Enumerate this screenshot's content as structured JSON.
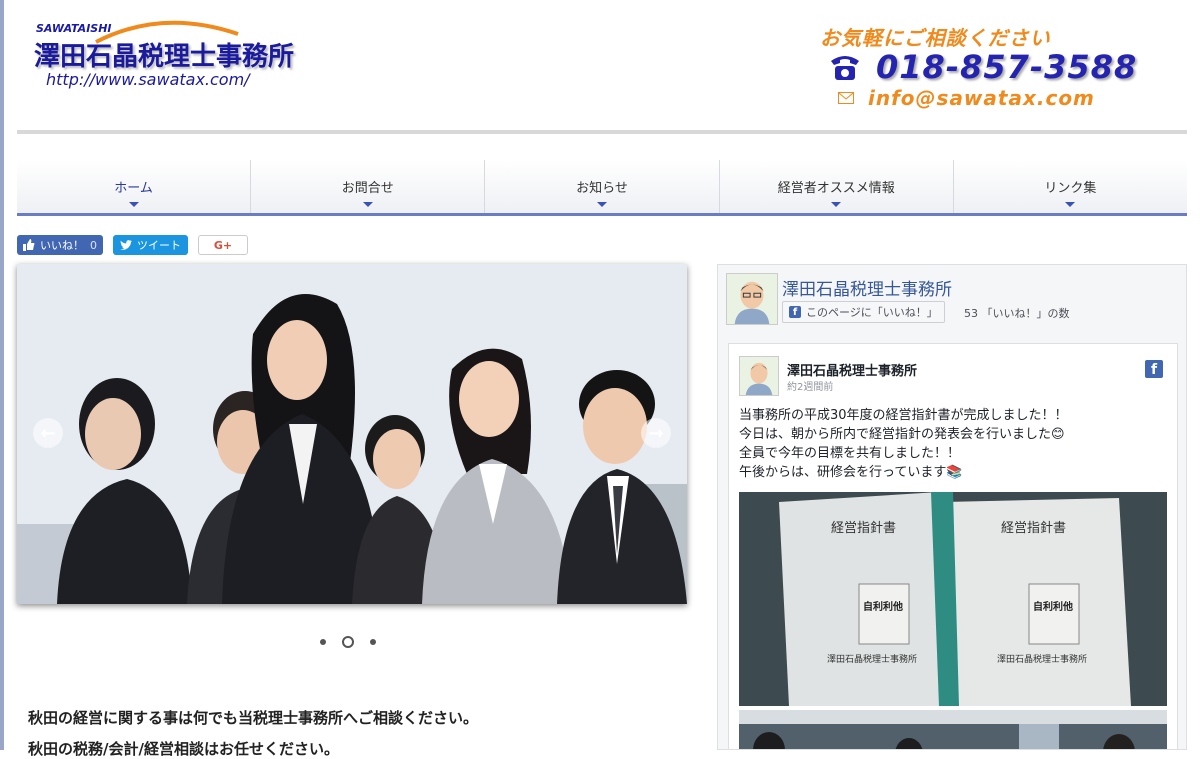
{
  "header": {
    "logo_small": "SAWATAISHI",
    "logo_name": "澤田石晶税理士事務所",
    "logo_url": "http://www.sawatax.com/",
    "contact_tagline": "お気軽にご相談ください",
    "phone": "018-857-3588",
    "email": "info@sawatax.com"
  },
  "nav": {
    "items": [
      {
        "label": "ホーム",
        "active": true
      },
      {
        "label": "お問合せ"
      },
      {
        "label": "お知らせ"
      },
      {
        "label": "経営者オススメ情報"
      },
      {
        "label": "リンク集"
      }
    ]
  },
  "social": {
    "like_label": "いいね！",
    "like_count": "0",
    "tweet_label": "ツイート",
    "gplus_label": "G+"
  },
  "slider": {
    "prev_arrow": "←",
    "next_arrow": "→",
    "dot_count": 3,
    "selected_dot": 1
  },
  "main": {
    "line1": "秋田の経営に関する事は何でも当税理士事務所へご相談ください。",
    "line2": "秋田の税務/会計/経営相談はお任せください。"
  },
  "facebook": {
    "page_name": "澤田石晶税理士事務所",
    "like_page_label": "このページに「いいね！」",
    "like_count_text": "53 「いいね！」の数",
    "post": {
      "author": "澤田石晶税理士事務所",
      "time": "約2週間前",
      "lines": [
        "当事務所の平成30年度の経営指針書が完成しました！！",
        "今日は、朝から所内で経営指針の発表会を行いました😊",
        "全員で今年の目標を共有しました！！",
        "午後からは、研修会を行っています📚"
      ],
      "photo_book_title": "経営指針書",
      "photo_book_title2": "経営指針書",
      "photo_book_motto": "自利利他",
      "photo_book_motto2": "自利利他",
      "photo_book_company": "澤田石晶税理士事務所",
      "photo_book_company2": "澤田石晶税理士事務所"
    }
  },
  "colors": {
    "brand_blue": "#1a1a9e",
    "accent_orange": "#f08a1c",
    "nav_underline": "#6b7dc2",
    "fb_blue": "#4267b2",
    "tweet_blue": "#1b95e0"
  }
}
